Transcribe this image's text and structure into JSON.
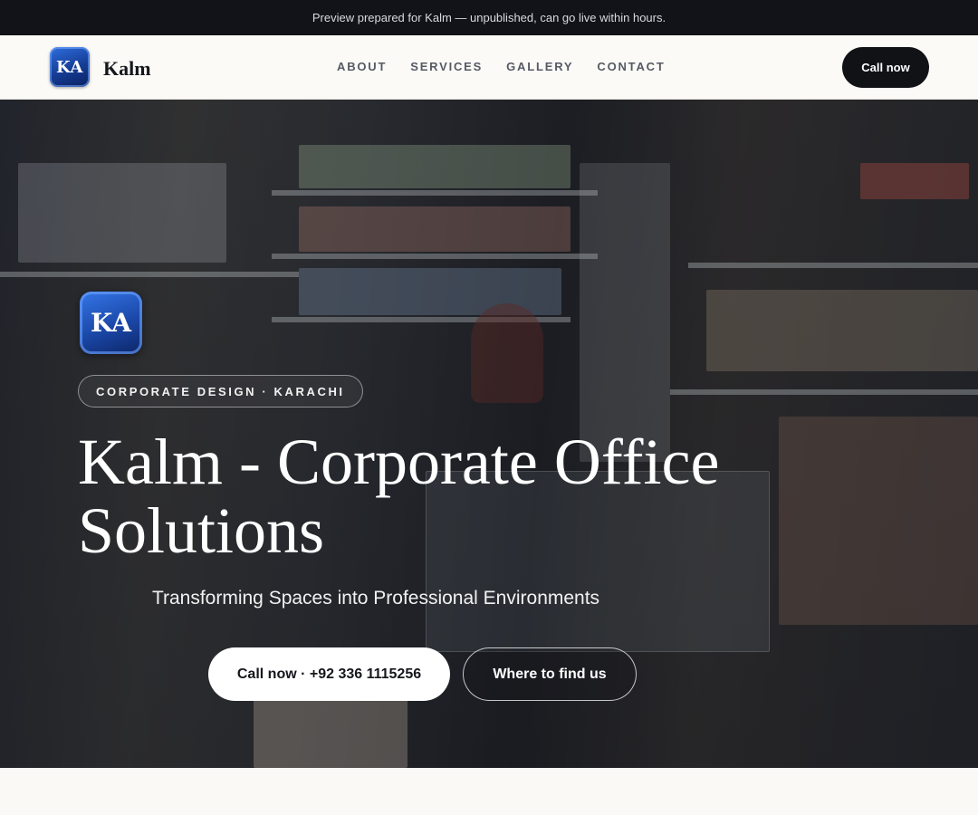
{
  "topbar": {
    "text": "Preview prepared for Kalm — unpublished, can go live within hours."
  },
  "header": {
    "logo_initials": "KA",
    "brand_name": "Kalm",
    "nav": [
      {
        "label": "ABOUT"
      },
      {
        "label": "SERVICES"
      },
      {
        "label": "GALLERY"
      },
      {
        "label": "CONTACT"
      }
    ],
    "call_button": "Call now"
  },
  "hero": {
    "logo_initials": "KA",
    "tag": "CORPORATE DESIGN · KARACHI",
    "title": "Kalm - Corporate Office Solutions",
    "subtitle": "Transforming Spaces into Professional Environments",
    "primary_button": "Call now · +92 336 1115256",
    "secondary_button": "Where to find us",
    "background_image": "shop interior photo (convenience store shelves)"
  },
  "colors": {
    "topbar_bg": "#111318",
    "header_bg": "#fbfaf7",
    "dark_button": "#101216",
    "logo_blue": "#1b48a8",
    "page_bg": "#faf9f6"
  }
}
